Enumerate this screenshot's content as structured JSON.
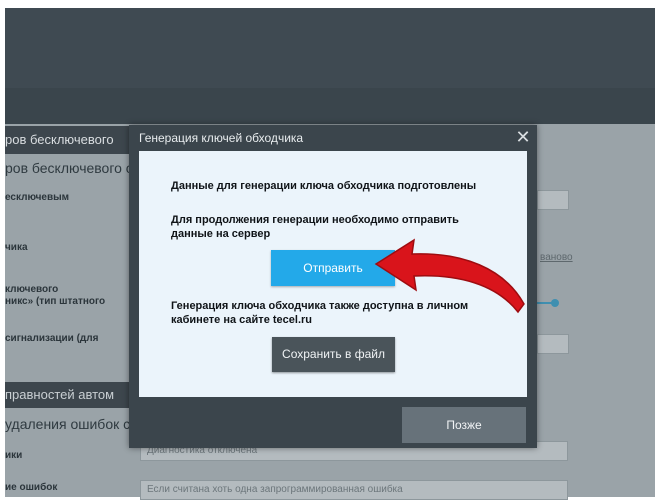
{
  "background": {
    "title": "ров бесключевого",
    "heading1": "ров бесключевого с",
    "labels": [
      "есключевым",
      "чика",
      "ключевого",
      "никс» (тип штатного",
      "сигнализации (для"
    ],
    "band": "правностей автом",
    "heading2": "удаления ошибок с",
    "labels2": [
      "ики",
      "ие ошибок"
    ],
    "link": "ваново",
    "input1": "Диагностика отключена",
    "input2": "Если считана хоть одна запрограммированная ошибка"
  },
  "dialog": {
    "title": "Генерация ключей обходчика",
    "close_glyph": "✕",
    "message1": "Данные для генерации ключа обходчика подготовлены",
    "message2_line1": "Для продолжения генерации необходимо отправить",
    "message2_line2": "данные на сервер",
    "send_label": "Отправить",
    "message3_line1": "Генерация ключа обходчика также доступна в личном",
    "message3_line2": "кабинете на сайте tecel.ru",
    "save_label": "Сохранить в файл",
    "later_label": "Позже"
  },
  "annotation": {
    "arrow_icon": "red-pointer-arrow",
    "arrow_color": "#d9141b"
  }
}
